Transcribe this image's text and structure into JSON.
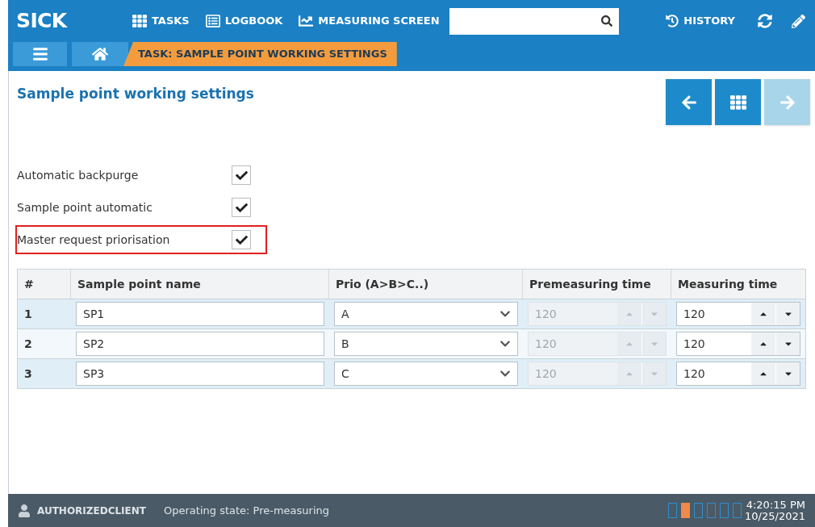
{
  "header": {
    "logo": "SICK",
    "nav": [
      {
        "kind": "tasks",
        "label": "TASKS"
      },
      {
        "kind": "logbook",
        "label": "LOGBOOK"
      },
      {
        "kind": "chart",
        "label": "MEASURING SCREEN"
      }
    ],
    "history": "HISTORY"
  },
  "breadcrumb": {
    "current": "TASK: SAMPLE POINT WORKING SETTINGS"
  },
  "page": {
    "title": "Sample point working settings"
  },
  "nav_buttons": [
    {
      "kind": "back",
      "disabled": false
    },
    {
      "kind": "grid",
      "disabled": false
    },
    {
      "kind": "forward",
      "disabled": true
    }
  ],
  "settings": [
    {
      "label": "Automatic backpurge",
      "checked": true,
      "highlighted": false
    },
    {
      "label": "Sample point automatic",
      "checked": true,
      "highlighted": false
    },
    {
      "label": "Master request priorisation",
      "checked": true,
      "highlighted": true
    }
  ],
  "table": {
    "columns": [
      "#",
      "Sample point name",
      "Prio (A>B>C..)",
      "Premeasuring time",
      "Measuring time"
    ],
    "rows": [
      {
        "index": "1",
        "name": "SP1",
        "prio": "A",
        "premeasuring": "120",
        "premeasuring_disabled": true,
        "measuring": "120"
      },
      {
        "index": "2",
        "name": "SP2",
        "prio": "B",
        "premeasuring": "120",
        "premeasuring_disabled": true,
        "measuring": "120"
      },
      {
        "index": "3",
        "name": "SP3",
        "prio": "C",
        "premeasuring": "120",
        "premeasuring_disabled": true,
        "measuring": "120"
      }
    ]
  },
  "status_bar": {
    "user": "AUTHORIZEDCLIENT",
    "state": "Operating state: Pre-measuring",
    "indicators": [
      {
        "on": false
      },
      {
        "on": true
      },
      {
        "on": false
      },
      {
        "on": false
      },
      {
        "on": false
      },
      {
        "on": false
      }
    ],
    "time": "4:20:15 PM",
    "date": "10/25/2021"
  }
}
